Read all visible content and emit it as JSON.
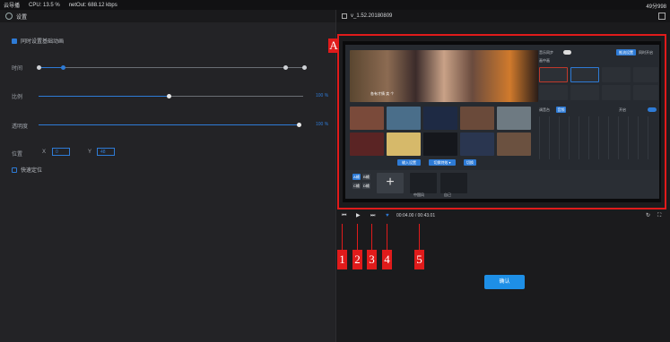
{
  "topbar": {
    "app_name": "云导播",
    "cpu": "CPU: 13.5 %",
    "net_out": "netOut: 688.12 kbps",
    "right_text": "49分998"
  },
  "left_panel": {
    "title": "设置",
    "sync_checkbox_label": "同时设置基础动画",
    "time_label": "时间",
    "ratio_label": "比例",
    "ratio_value": "100 %",
    "opacity_label": "透明度",
    "opacity_value": "100 %",
    "position_label": "位置",
    "x_label": "X",
    "x_value": "0",
    "y_label": "Y",
    "y_value": "48",
    "quick_position_label": "快速定位"
  },
  "right_panel": {
    "file_title": "v_1.52.20180809",
    "preview": {
      "caption": "各有才情 卖 个",
      "toggle_labels": [
        "音乐同步 ",
        "推流设置",
        "同时开启"
      ],
      "group_label": "画中画",
      "audio_label": "调音台",
      "audio_btn": "音频",
      "bottom_buttons": [
        "输入设置",
        "切换特效 ▾",
        "切换"
      ],
      "mode_buttons": [
        "A输",
        "B输",
        "C输",
        "D输"
      ],
      "sources": [
        "中国风",
        "自己"
      ],
      "switch_label": "开启"
    },
    "timecode": "00:04.00 / 00:43.01",
    "confirm_label": "确认"
  },
  "annotations": {
    "box_a_label": "A",
    "markers": [
      "1",
      "2",
      "3",
      "4",
      "5"
    ]
  },
  "colors": {
    "accent": "#2e7bd6",
    "annotation_red": "#e01b1b",
    "confirm_blue": "#1e8fe6"
  },
  "sliders": {
    "time_range": [
      0.0,
      1.0
    ],
    "ratio_fraction": 0.5,
    "opacity_fraction": 1.0
  }
}
